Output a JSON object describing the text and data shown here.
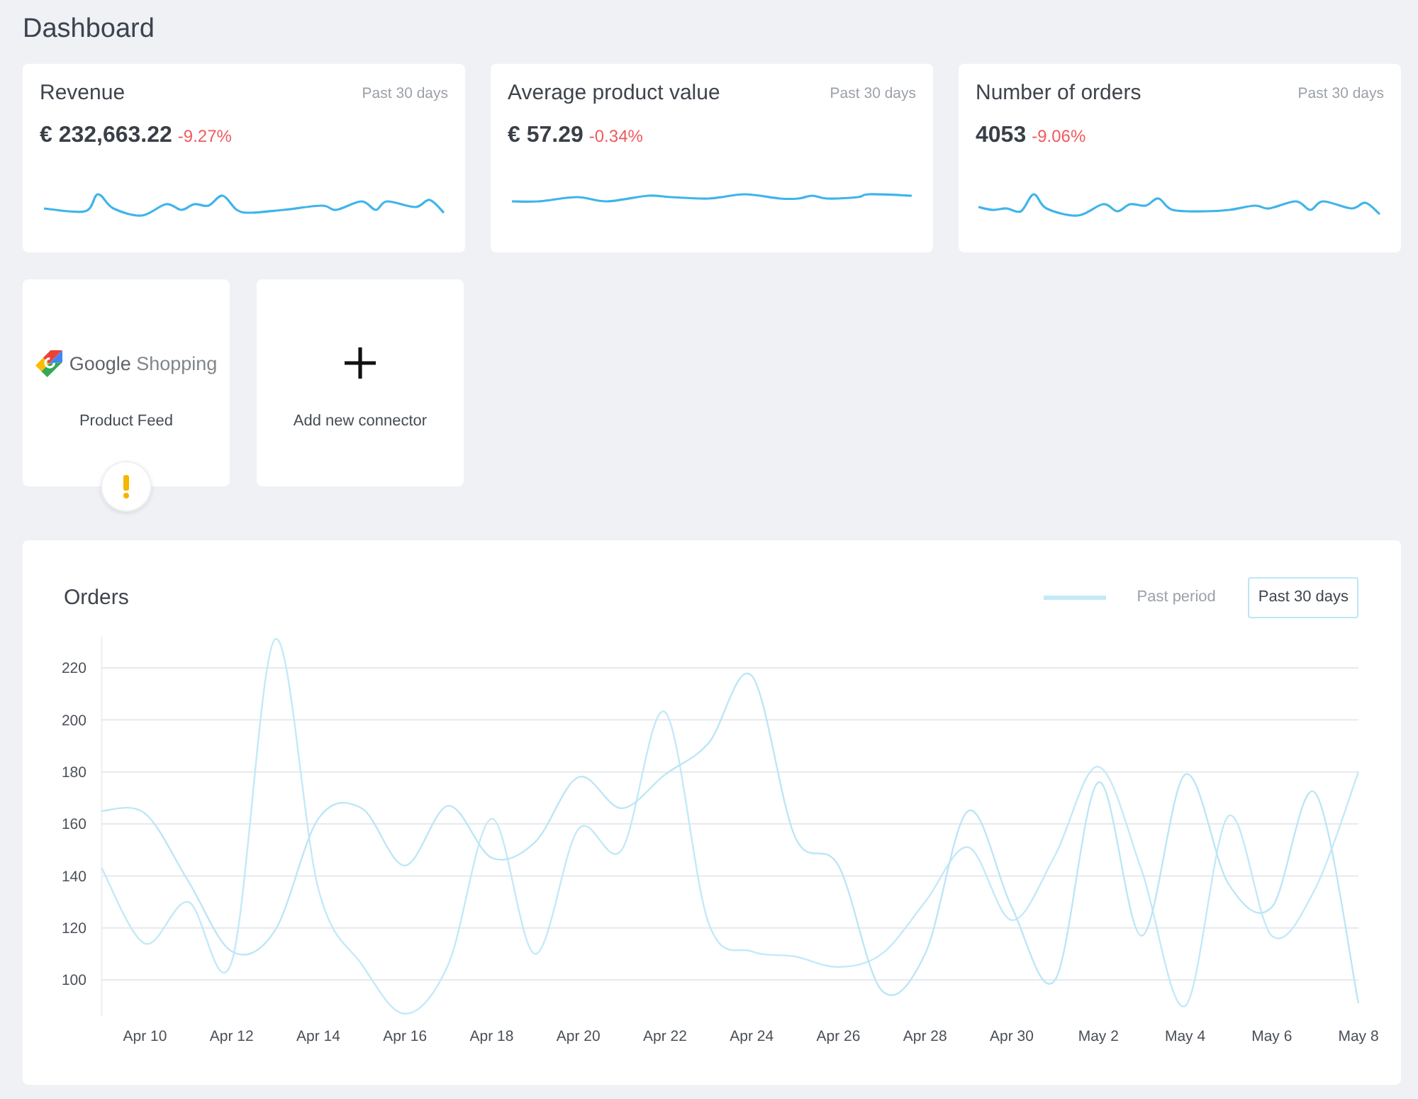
{
  "page": {
    "title": "Dashboard"
  },
  "metrics": [
    {
      "title": "Revenue",
      "period": "Past 30 days",
      "value": "€ 232,663.22",
      "change": "-9.27%"
    },
    {
      "title": "Average product value",
      "period": "Past 30 days",
      "value": "€ 57.29",
      "change": "-0.34%"
    },
    {
      "title": "Number of orders",
      "period": "Past 30 days",
      "value": "4053",
      "change": "-9.06%"
    }
  ],
  "connectors": [
    {
      "kind": "feed",
      "logo_brand": "Google",
      "logo_product": "Shopping",
      "label": "Product Feed",
      "warning": true
    },
    {
      "kind": "add",
      "label": "Add new connector",
      "warning": false
    }
  ],
  "orders": {
    "legend": [
      {
        "kind": "line"
      },
      {
        "kind": "box"
      }
    ],
    "chart_data": {
      "type": "line",
      "title": "Orders",
      "categories": [
        null,
        "Apr 10",
        null,
        "Apr 12",
        null,
        "Apr 14",
        null,
        "Apr 16",
        null,
        "Apr 18",
        null,
        "Apr 20",
        null,
        "Apr 22",
        null,
        "Apr 24",
        null,
        "Apr 26",
        null,
        "Apr 28",
        null,
        "Apr 30",
        null,
        "May 2",
        null,
        "May 4",
        null,
        "May 6",
        null,
        "May 8"
      ],
      "ylim": [
        86,
        232
      ],
      "yticks": [
        100,
        120,
        140,
        160,
        180,
        200,
        220
      ],
      "grid": true,
      "series": [
        {
          "name": "Past period",
          "color": "#c4e9f8",
          "values": [
            143,
            114,
            130,
            107,
            231,
            135,
            106,
            87,
            106,
            162,
            110,
            158,
            150,
            203,
            122,
            111,
            109,
            105,
            110,
            130,
            151,
            123,
            148,
            182,
            142,
            90,
            163,
            117,
            135,
            180
          ]
        },
        {
          "name": "Past 30 days",
          "color": "#bde6f6",
          "values": [
            165,
            164,
            138,
            111,
            119,
            162,
            166,
            144,
            167,
            147,
            153,
            178,
            166,
            179,
            191,
            217,
            155,
            144,
            96,
            110,
            165,
            128,
            100,
            176,
            117,
            179,
            137,
            128,
            172,
            91
          ]
        }
      ]
    }
  }
}
